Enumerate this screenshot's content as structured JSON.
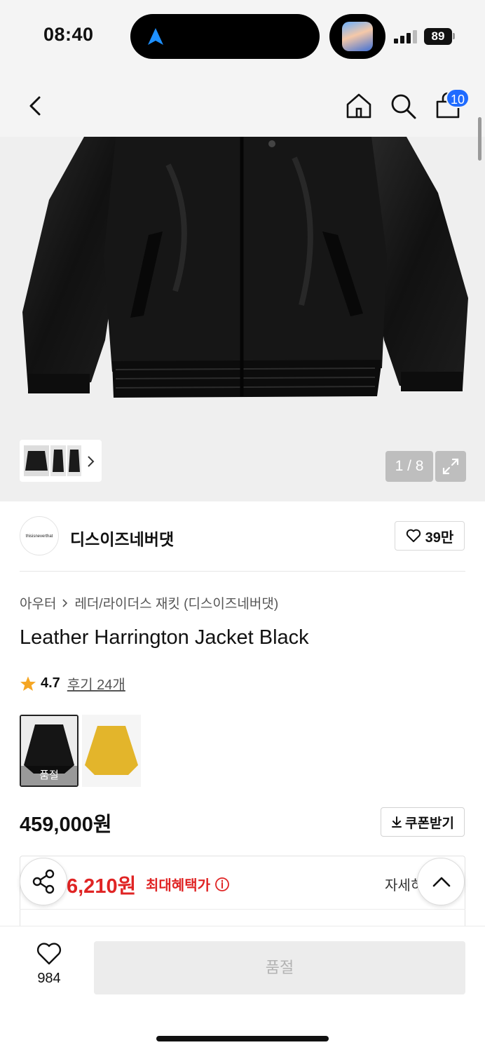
{
  "status_bar": {
    "time": "08:40",
    "battery": "89"
  },
  "header": {
    "cart_count": "10",
    "icons": [
      "back-icon",
      "home-icon",
      "search-icon",
      "cart-icon"
    ]
  },
  "gallery": {
    "counter": "1 / 8"
  },
  "brand": {
    "logo_text": "thisisneverthat",
    "name": "디스이즈네버댓",
    "likes": "39만"
  },
  "breadcrumb": {
    "category": "아우터",
    "subcategory": "레더/라이더스 재킷 (디스이즈네버댓)"
  },
  "product": {
    "title": "Leather Harrington Jacket Black",
    "rating": "4.7",
    "reviews": "후기 24개",
    "swatch_soldout": "품절",
    "price": "459,000원",
    "coupon_label": "쿠폰받기"
  },
  "benefit": {
    "price": "6,210원",
    "label": "최대혜택가",
    "detail": "자세히"
  },
  "bottom": {
    "wish_count": "984",
    "buy_label": "품절"
  },
  "colors": {
    "accent_blue": "#1f6bff",
    "benefit_red": "#e02424",
    "star": "#f5a623"
  }
}
